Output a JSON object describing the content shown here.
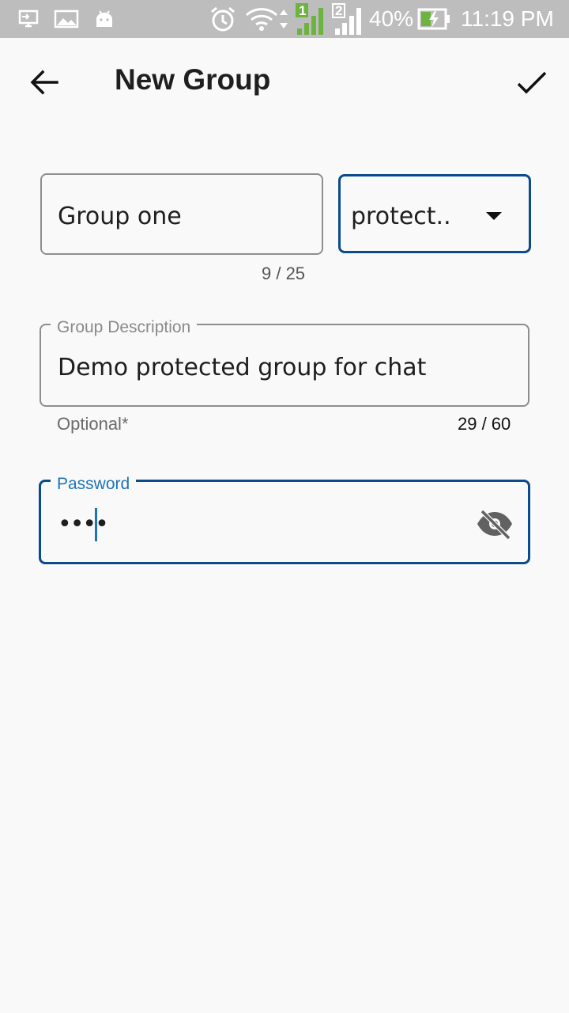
{
  "status_bar": {
    "battery_percent": "40%",
    "time": "11:19 PM",
    "sim1_label": "1",
    "sim2_label": "2",
    "icons": [
      "screen-cast-icon",
      "image-icon",
      "android-icon",
      "alarm-icon",
      "wifi-icon",
      "signal-sim1-icon",
      "signal-sim2-icon",
      "battery-charging-icon"
    ],
    "sim1_color": "#6db33f"
  },
  "app_bar": {
    "title": "New Group",
    "back_icon": "arrow-back-icon",
    "confirm_icon": "check-icon"
  },
  "form": {
    "group_name": {
      "value": "Group one",
      "counter": "9 / 25"
    },
    "group_type": {
      "selected": "protect..",
      "icon": "dropdown-arrow-icon"
    },
    "description": {
      "label": "Group Description",
      "value": "Demo protected group for chat",
      "helper": "Optional*",
      "counter": "29 / 60"
    },
    "password": {
      "label": "Password",
      "value": "••••",
      "toggle_icon": "visibility-off-icon"
    }
  },
  "colors": {
    "accent": "#0b4a8b",
    "label_active": "#1e73b8",
    "status_bar": "#bdbdbd",
    "background": "#f9f9f9"
  }
}
